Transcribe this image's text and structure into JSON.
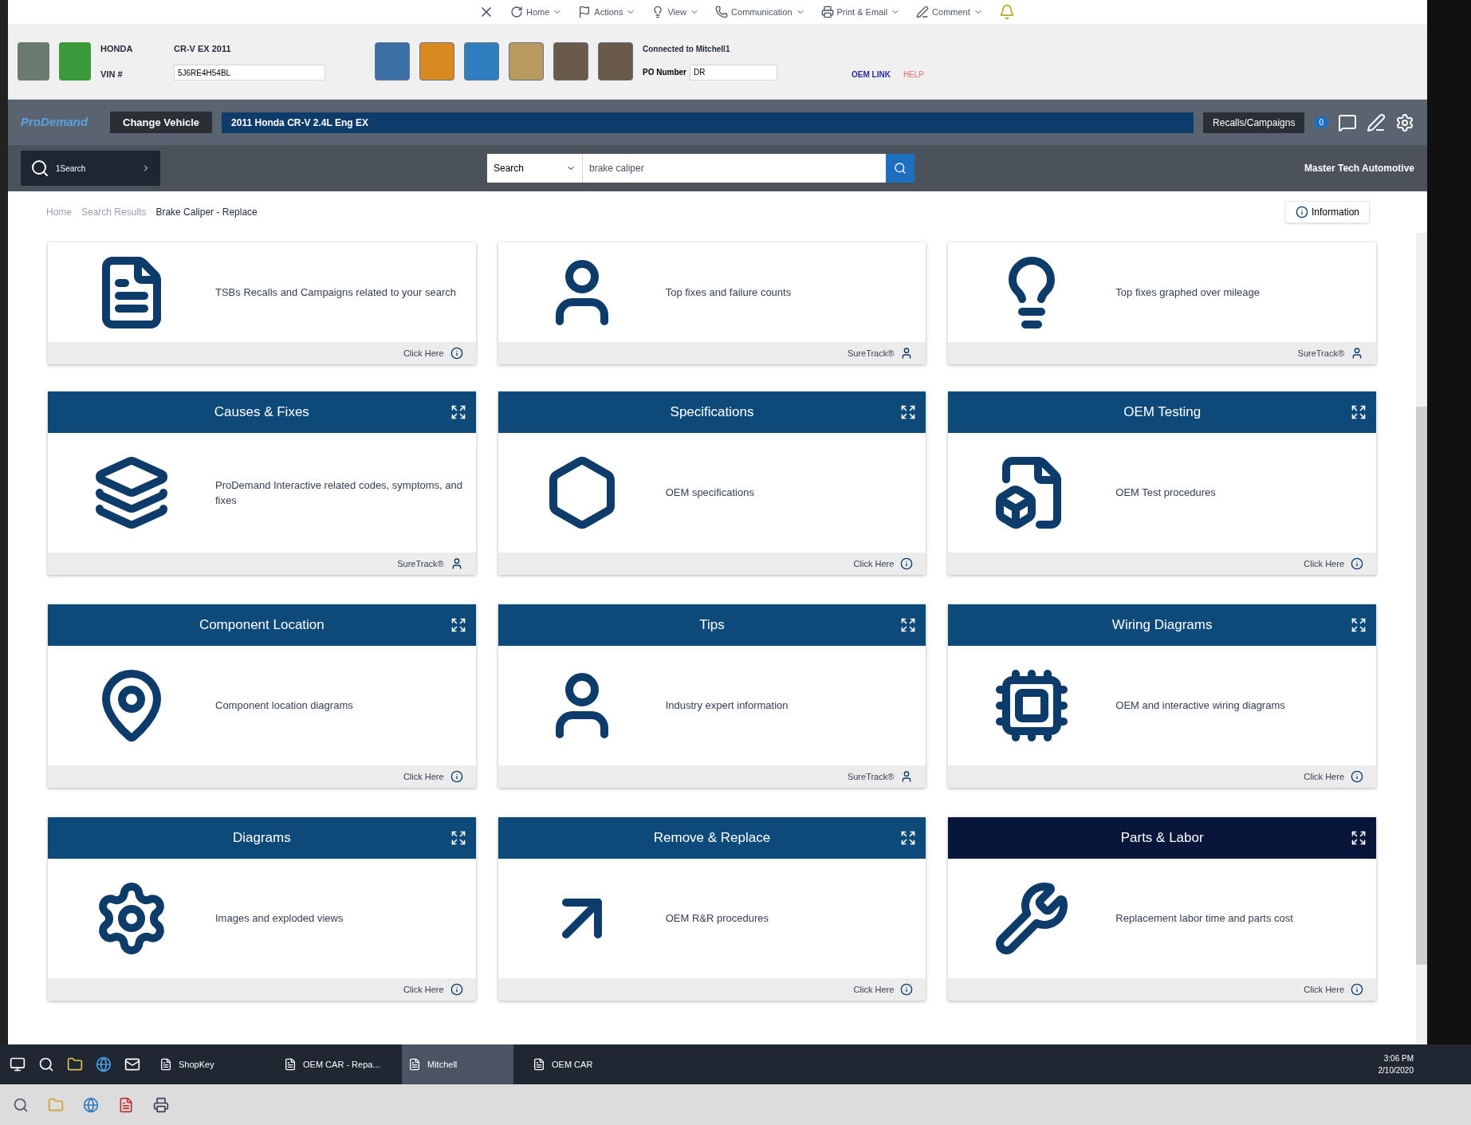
{
  "app_toolbar": {
    "menu": [
      "Home",
      "Actions",
      "View",
      "Communication",
      "Print & Email",
      "Comment"
    ],
    "make": "HONDA",
    "vehicle": "CR-V EX 2011",
    "vin_label": "VIN #",
    "vin_value": "5J6RE4H54BL",
    "notice": "Connected to Mitchell1",
    "po_label": "PO Number",
    "po_value": "DR",
    "link": "OEM LINK",
    "link2": "HELP"
  },
  "header": {
    "logo": "ProDemand",
    "change_vehicle": "Change Vehicle",
    "vehicle": "2011 Honda CR-V 2.4L Eng EX",
    "recalls": "Recalls/Campaigns",
    "recall_count": "0"
  },
  "search_bar": {
    "selector": "1Search",
    "search_type": "Search",
    "query": "brake caliper",
    "shop": "Master Tech Automotive"
  },
  "breadcrumb": [
    "Home",
    "Search Results",
    "Brake Caliper - Replace"
  ],
  "info_button": "Information",
  "top_cards": [
    {
      "text": "TSBs Recalls and Campaigns related to your search",
      "footer": "Click Here"
    },
    {
      "text": "Top fixes and failure counts",
      "footer": "SureTrack®"
    },
    {
      "text": "Top fixes graphed over mileage",
      "footer": "SureTrack®"
    }
  ],
  "cards": [
    {
      "title": "Causes & Fixes",
      "text": "ProDemand Interactive related codes, symptoms, and fixes",
      "footer": "SureTrack®",
      "selected": false
    },
    {
      "title": "Specifications",
      "text": "OEM specifications",
      "footer": "Click Here",
      "selected": false
    },
    {
      "title": "OEM Testing",
      "text": "OEM Test procedures",
      "footer": "Click Here",
      "selected": false
    },
    {
      "title": "Component Location",
      "text": "Component location diagrams",
      "footer": "Click Here",
      "selected": false
    },
    {
      "title": "Tips",
      "text": "Industry expert information",
      "footer": "SureTrack®",
      "selected": false
    },
    {
      "title": "Wiring Diagrams",
      "text": "OEM and interactive wiring diagrams",
      "footer": "Click Here",
      "selected": false
    },
    {
      "title": "Diagrams",
      "text": "Images and exploded views",
      "footer": "Click Here",
      "selected": false
    },
    {
      "title": "Remove & Replace",
      "text": "OEM R&R procedures",
      "footer": "Click Here",
      "selected": false
    },
    {
      "title": "Parts & Labor",
      "text": "Replacement labor time and parts cost",
      "footer": "Click Here",
      "selected": true
    }
  ],
  "taskbar": {
    "windows": [
      {
        "label": "ShopKey",
        "selected": false
      },
      {
        "label": "OEM CAR - Repa...",
        "selected": false
      },
      {
        "label": "Mitchell",
        "selected": true
      },
      {
        "label": "OEM CAR",
        "selected": false
      }
    ],
    "time": "3:06 PM",
    "date": "2/10/2020"
  }
}
